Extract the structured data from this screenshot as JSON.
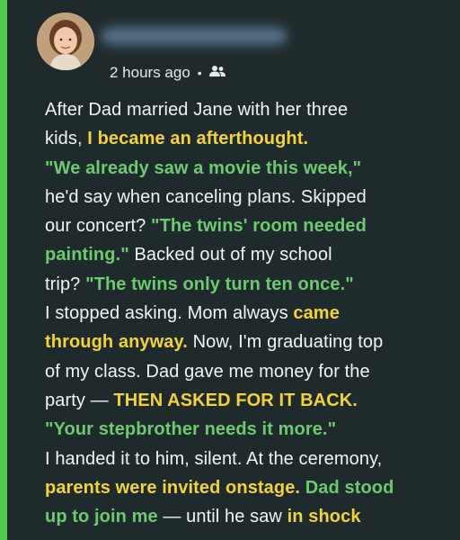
{
  "post": {
    "timestamp": "2 hours ago",
    "separator": "•",
    "audience_icon": "friends-icon",
    "lines": [
      [
        {
          "t": "After Dad married Jane with her three",
          "c": ""
        }
      ],
      [
        {
          "t": "kids, ",
          "c": ""
        },
        {
          "t": "I became an afterthought.",
          "c": "y"
        }
      ],
      [
        {
          "t": "\"We already saw a movie this week,\"",
          "c": "g"
        }
      ],
      [
        {
          "t": "he'd say when canceling plans. Skipped",
          "c": ""
        }
      ],
      [
        {
          "t": "our concert? ",
          "c": ""
        },
        {
          "t": "\"The twins' room needed",
          "c": "g"
        }
      ],
      [
        {
          "t": "painting.\"",
          "c": "g"
        },
        {
          "t": " Backed out of my school",
          "c": ""
        }
      ],
      [
        {
          "t": "trip? ",
          "c": ""
        },
        {
          "t": "\"The twins only turn ten once.\"",
          "c": "g"
        }
      ],
      [
        {
          "t": "I stopped asking. Mom always ",
          "c": ""
        },
        {
          "t": "came",
          "c": "y"
        }
      ],
      [
        {
          "t": "through anyway.",
          "c": "y"
        },
        {
          "t": " Now, I'm graduating top",
          "c": ""
        }
      ],
      [
        {
          "t": "of my class. Dad gave me money for the",
          "c": ""
        }
      ],
      [
        {
          "t": "party — ",
          "c": ""
        },
        {
          "t": "THEN ASKED FOR IT BACK.",
          "c": "y"
        }
      ],
      [
        {
          "t": "\"Your stepbrother needs it more.\"",
          "c": "g"
        }
      ],
      [
        {
          "t": "I handed it to him, silent. At the ceremony,",
          "c": ""
        }
      ],
      [
        {
          "t": "parents were invited onstage.",
          "c": "y"
        },
        {
          "t": " ",
          "c": ""
        },
        {
          "t": "Dad stood",
          "c": "g"
        }
      ],
      [
        {
          "t": "up to join me",
          "c": "g"
        },
        {
          "t": " — until he saw ",
          "c": ""
        },
        {
          "t": "in shock",
          "c": "y"
        }
      ]
    ]
  },
  "colors": {
    "background": "#1f2a2d",
    "accent_border": "#4cc94e",
    "highlight_yellow": "#f3d23c",
    "highlight_green": "#6ccb6f"
  }
}
